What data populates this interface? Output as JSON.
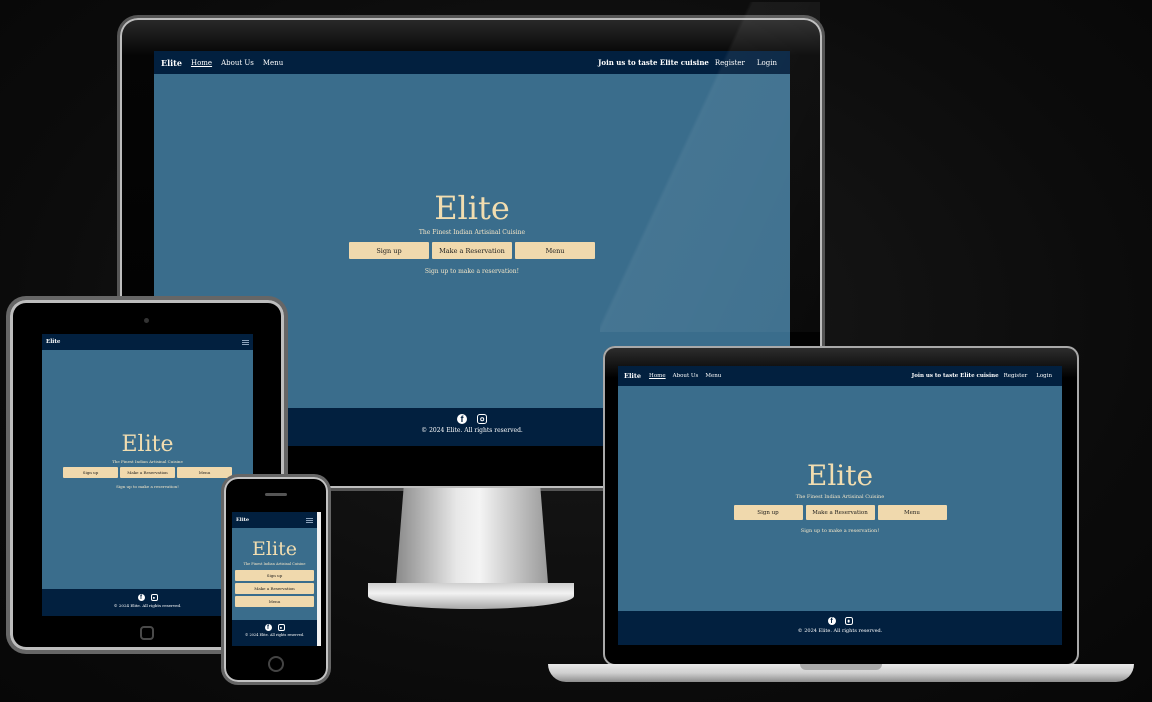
{
  "site": {
    "brand": "Elite",
    "nav": {
      "home": "Home",
      "about": "About Us",
      "menu": "Menu"
    },
    "tagline": "Join us to taste Elite cuisine",
    "register": "Register",
    "login": "Login",
    "hero_title": "Elite",
    "subtitle": "The Finest Indian Artisinal Cuisine",
    "buttons": {
      "signup": "Sign up",
      "reservation": "Make a Reservation",
      "menu": "Menu"
    },
    "cta": "Sign up to make a reservation!",
    "copyright": "© 2024 Elite. All rights reserved.",
    "icons": [
      "facebook-icon",
      "instagram-icon",
      "hamburger-menu-icon"
    ]
  },
  "colors": {
    "navbar": "#02203f",
    "hero_bg": "#3a6d8c",
    "button": "#f0d9ad",
    "title": "#f1ddb0"
  }
}
